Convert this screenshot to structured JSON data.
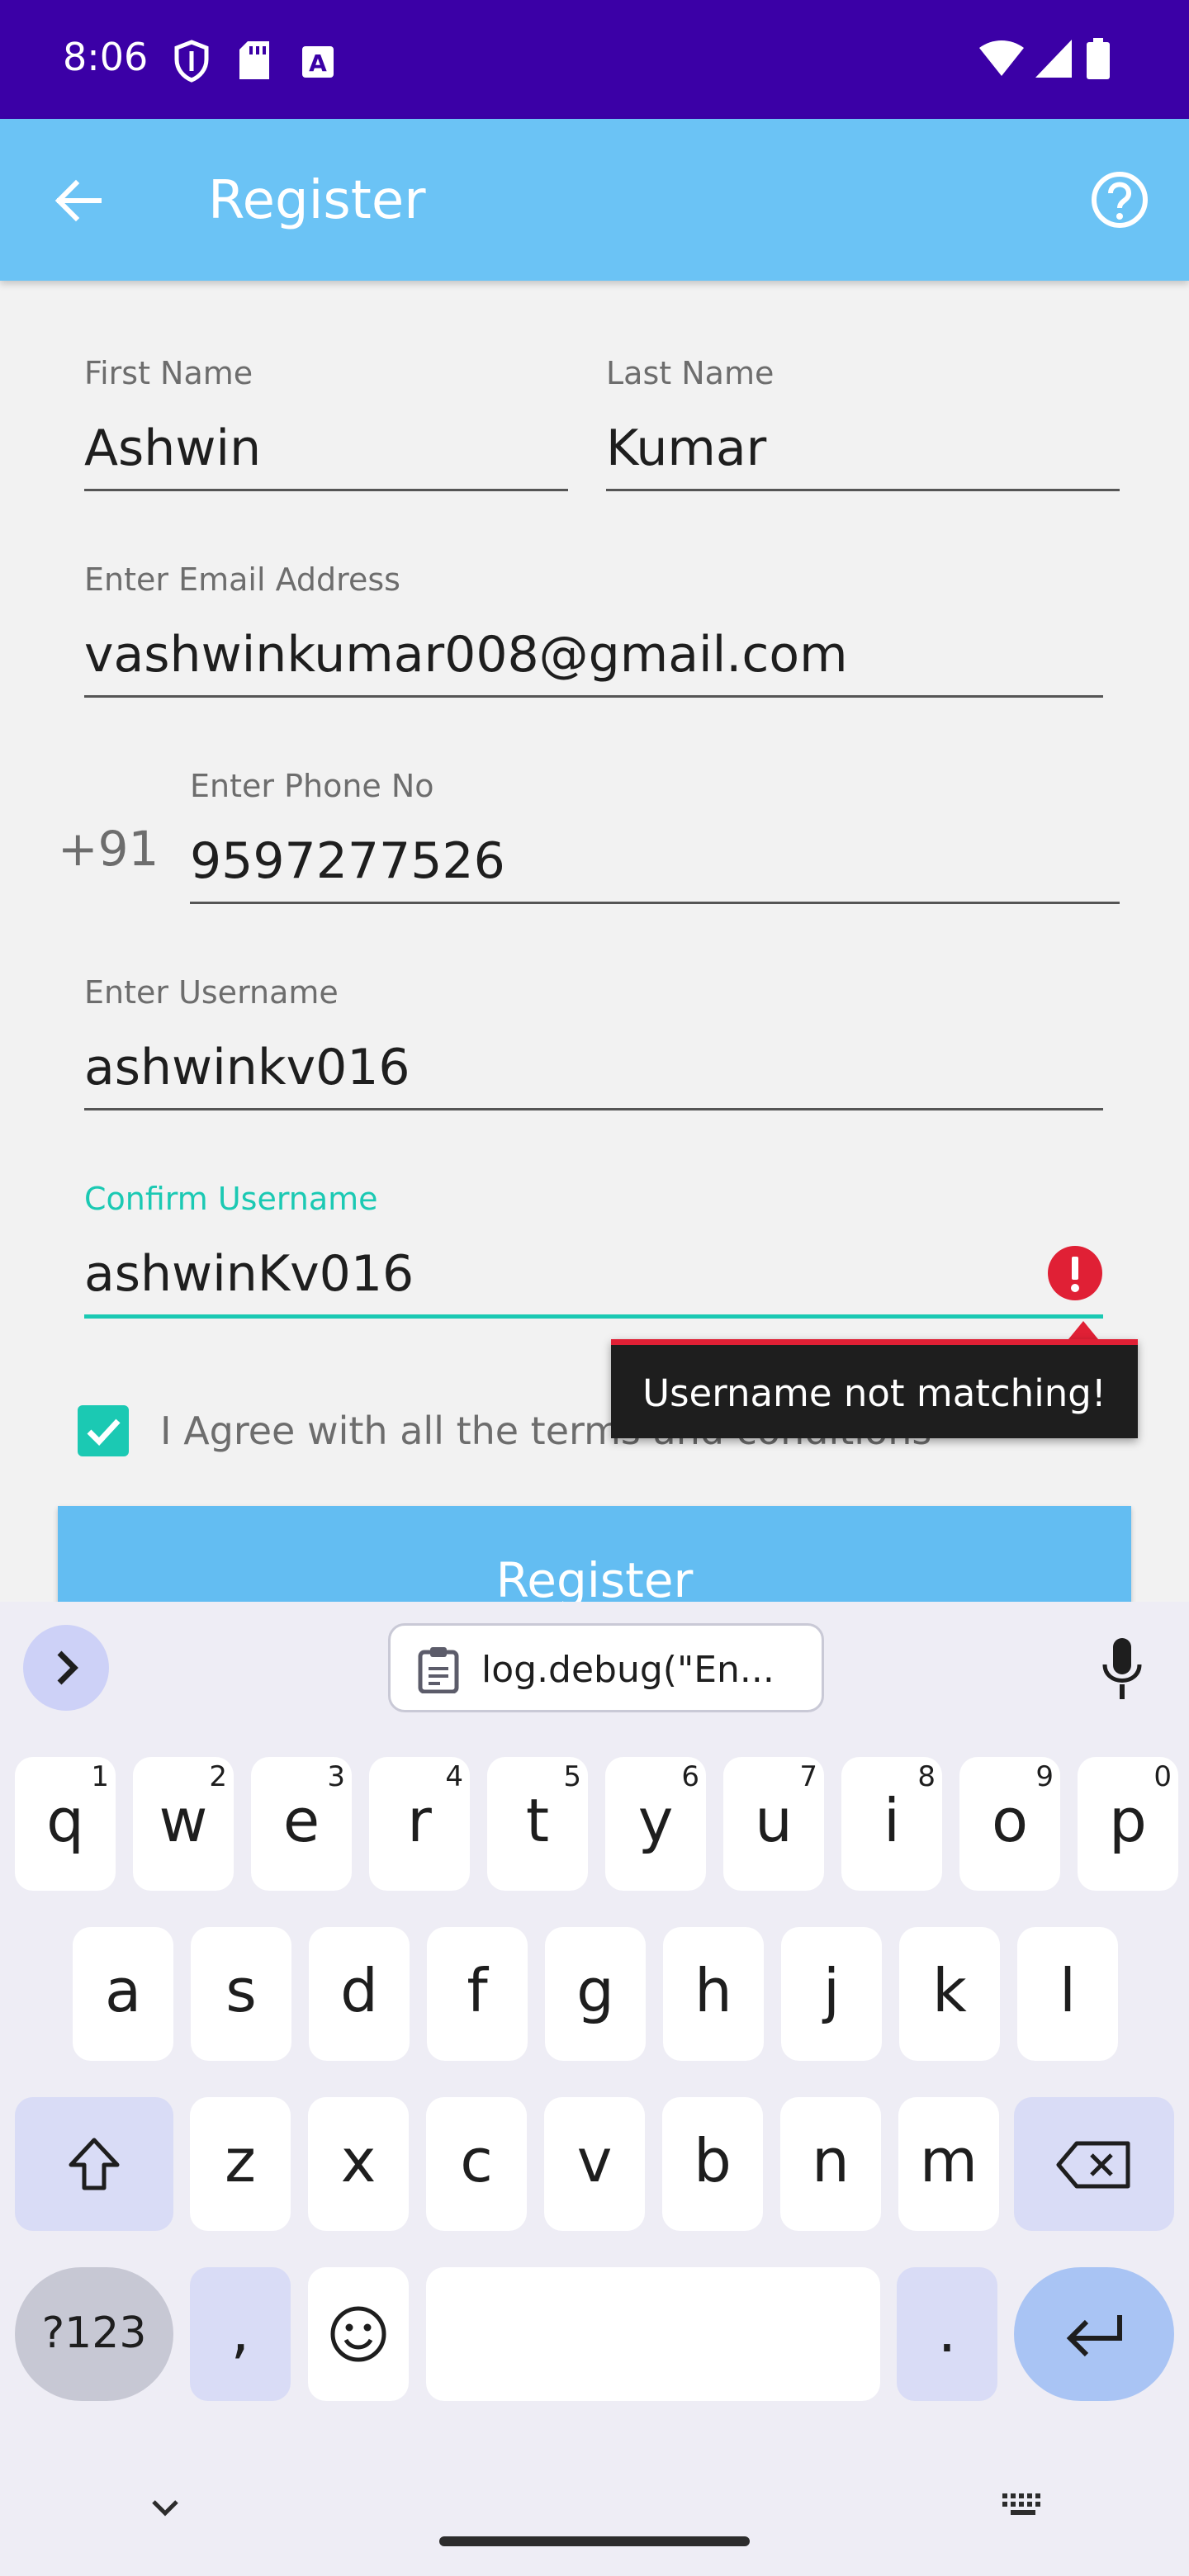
{
  "status_bar": {
    "time": "8:06"
  },
  "app_bar": {
    "title": "Register"
  },
  "form": {
    "first_name": {
      "label": "First Name",
      "value": "Ashwin"
    },
    "last_name": {
      "label": "Last Name",
      "value": "Kumar"
    },
    "email": {
      "label": "Enter Email Address",
      "value": "vashwinkumar008@gmail.com"
    },
    "phone": {
      "prefix": "+91",
      "label": "Enter Phone No",
      "value": "9597277526"
    },
    "username": {
      "label": "Enter Username",
      "value": "ashwinkv016"
    },
    "confirm_username": {
      "label": "Confirm Username",
      "value": "ashwinKv016",
      "error": "Username not matching!"
    },
    "agree": {
      "label": "I Agree with all the terms and conditions",
      "checked": true
    },
    "register_button": "Register"
  },
  "keyboard": {
    "clipboard_text": "log.debug(\"En...",
    "row1": [
      {
        "ch": "q",
        "num": "1"
      },
      {
        "ch": "w",
        "num": "2"
      },
      {
        "ch": "e",
        "num": "3"
      },
      {
        "ch": "r",
        "num": "4"
      },
      {
        "ch": "t",
        "num": "5"
      },
      {
        "ch": "y",
        "num": "6"
      },
      {
        "ch": "u",
        "num": "7"
      },
      {
        "ch": "i",
        "num": "8"
      },
      {
        "ch": "o",
        "num": "9"
      },
      {
        "ch": "p",
        "num": "0"
      }
    ],
    "row2": [
      "a",
      "s",
      "d",
      "f",
      "g",
      "h",
      "j",
      "k",
      "l"
    ],
    "row3": [
      "z",
      "x",
      "c",
      "v",
      "b",
      "n",
      "m"
    ],
    "symbols_key": "?123",
    "comma_key": ",",
    "period_key": "."
  },
  "colors": {
    "status_bar": "#3b00a6",
    "app_bar": "#6bc3f5",
    "accent": "#1bc9b3",
    "error": "#e02035"
  }
}
